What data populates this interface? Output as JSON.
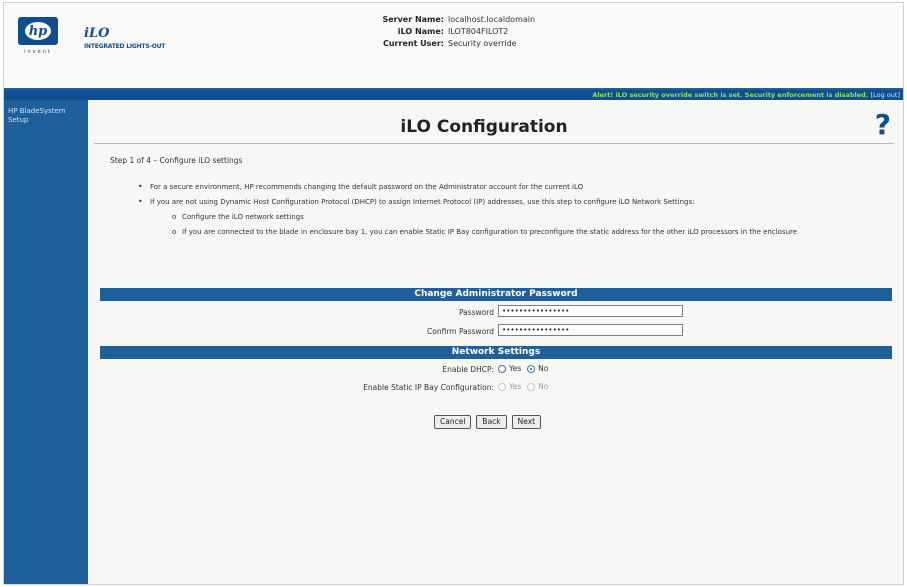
{
  "brand": {
    "hp_logo_text": "hp",
    "hp_tagline": "invent",
    "product": "iLO",
    "product_subtitle": "INTEGRATED LIGHTS-OUT"
  },
  "server_info": {
    "server_name_label": "Server Name:",
    "server_name_value": "localhost.localdomain",
    "ilo_name_label": "iLO Name:",
    "ilo_name_value": "ILOT804FILOT2",
    "current_user_label": "Current User:",
    "current_user_value": "Security override"
  },
  "alert": {
    "text": "Alert! iLO security override switch is set. Security enforcement is disabled.",
    "logout": "Log out"
  },
  "sidebar": {
    "items": [
      "HP BladeSystem Setup"
    ]
  },
  "page": {
    "title": "iLO Configuration",
    "help_icon": "?",
    "step": "Step 1 of 4 – Configure iLO settings",
    "bullets": [
      "For a secure environment, HP recommends changing the default password on the Administrator account for the current iLO",
      "If you are not using Dynamic Host Configuration Protocol (DHCP) to assign Internet Protocol (IP) addresses, use this step to configure iLO Network Settings:"
    ],
    "sub_bullets": [
      "Configure the iLO network settings",
      "If you are connected to the blade in enclosure bay 1, you can enable Static IP Bay configuration to preconfigure the static address for the other iLO processors in the enclosure"
    ]
  },
  "form": {
    "password_section": "Change Administrator Password",
    "password_label": "Password",
    "password_value": "••••••••••••••••",
    "confirm_label": "Confirm Password",
    "confirm_value": "••••••••••••••••",
    "network_section": "Network Settings",
    "dhcp_label": "Enable DHCP:",
    "dhcp_yes": "Yes",
    "dhcp_no": "No",
    "dhcp_selected": "No",
    "static_ip_label": "Enable Static IP Bay Configuration:",
    "static_yes": "Yes",
    "static_no": "No"
  },
  "buttons": {
    "cancel": "Cancel",
    "back": "Back",
    "next": "Next"
  },
  "colors": {
    "accent": "#1f5f9b",
    "alert_text": "#9fe03a"
  }
}
